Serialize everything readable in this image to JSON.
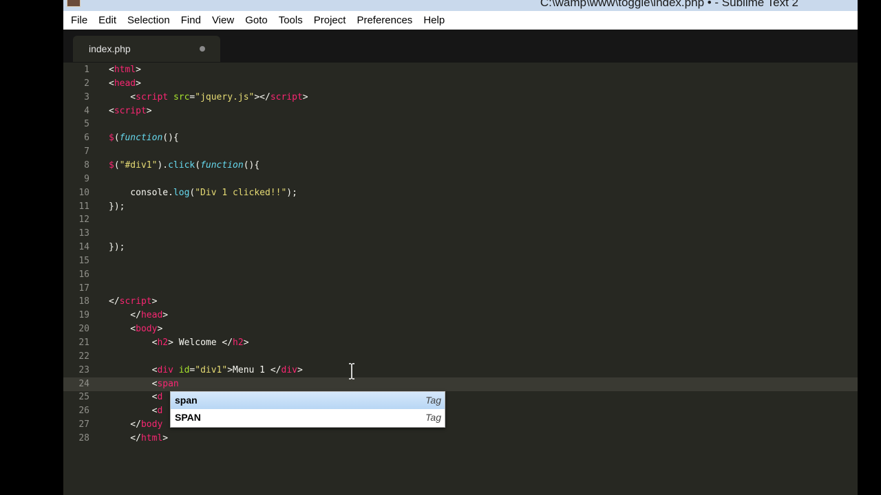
{
  "window": {
    "title": "C:\\wamp\\www\\toggle\\index.php • - Sublime Text 2"
  },
  "menu": [
    "File",
    "Edit",
    "Selection",
    "Find",
    "View",
    "Goto",
    "Tools",
    "Project",
    "Preferences",
    "Help"
  ],
  "tab": {
    "label": "index.php",
    "modified": true
  },
  "code_lines": [
    {
      "n": "1",
      "segs": [
        [
          "t-plain",
          "<"
        ],
        [
          "t-tag",
          "html"
        ],
        [
          "t-plain",
          ">"
        ]
      ]
    },
    {
      "n": "2",
      "segs": [
        [
          "t-plain",
          "<"
        ],
        [
          "t-tag",
          "head"
        ],
        [
          "t-plain",
          ">"
        ]
      ]
    },
    {
      "n": "3",
      "segs": [
        [
          "t-plain",
          "    <"
        ],
        [
          "t-tag",
          "script"
        ],
        [
          "t-plain",
          " "
        ],
        [
          "t-attr",
          "src"
        ],
        [
          "t-plain",
          "="
        ],
        [
          "t-str",
          "\"jquery.js\""
        ],
        [
          "t-plain",
          "></"
        ],
        [
          "t-tag",
          "script"
        ],
        [
          "t-plain",
          ">"
        ]
      ]
    },
    {
      "n": "4",
      "segs": [
        [
          "t-plain",
          "<"
        ],
        [
          "t-tag",
          "script"
        ],
        [
          "t-plain",
          ">"
        ]
      ]
    },
    {
      "n": "5",
      "segs": []
    },
    {
      "n": "6",
      "segs": [
        [
          "t-tag",
          "$"
        ],
        [
          "t-plain",
          "("
        ],
        [
          "t-fn",
          "function"
        ],
        [
          "t-plain",
          "(){"
        ]
      ]
    },
    {
      "n": "7",
      "segs": []
    },
    {
      "n": "8",
      "segs": [
        [
          "t-tag",
          "$"
        ],
        [
          "t-plain",
          "("
        ],
        [
          "t-str",
          "\"#div1\""
        ],
        [
          "t-plain",
          ")."
        ],
        [
          "t-call",
          "click"
        ],
        [
          "t-plain",
          "("
        ],
        [
          "t-fn",
          "function"
        ],
        [
          "t-plain",
          "(){"
        ]
      ]
    },
    {
      "n": "9",
      "segs": []
    },
    {
      "n": "10",
      "segs": [
        [
          "t-plain",
          "    console."
        ],
        [
          "t-call",
          "log"
        ],
        [
          "t-plain",
          "("
        ],
        [
          "t-str",
          "\"Div 1 clicked!!\""
        ],
        [
          "t-plain",
          ");"
        ]
      ]
    },
    {
      "n": "11",
      "segs": [
        [
          "t-plain",
          "});"
        ]
      ]
    },
    {
      "n": "12",
      "segs": []
    },
    {
      "n": "13",
      "segs": []
    },
    {
      "n": "14",
      "segs": [
        [
          "t-plain",
          "});"
        ]
      ]
    },
    {
      "n": "15",
      "segs": []
    },
    {
      "n": "16",
      "segs": []
    },
    {
      "n": "17",
      "segs": []
    },
    {
      "n": "18",
      "segs": [
        [
          "t-plain",
          "</"
        ],
        [
          "t-tag",
          "script"
        ],
        [
          "t-plain",
          ">"
        ]
      ]
    },
    {
      "n": "19",
      "segs": [
        [
          "t-plain",
          "    </"
        ],
        [
          "t-tag",
          "head"
        ],
        [
          "t-plain",
          ">"
        ]
      ]
    },
    {
      "n": "20",
      "segs": [
        [
          "t-plain",
          "    <"
        ],
        [
          "t-tag",
          "body"
        ],
        [
          "t-plain",
          ">"
        ]
      ]
    },
    {
      "n": "21",
      "segs": [
        [
          "t-plain",
          "        <"
        ],
        [
          "t-tag",
          "h2"
        ],
        [
          "t-plain",
          "> Welcome </"
        ],
        [
          "t-tag",
          "h2"
        ],
        [
          "t-plain",
          ">"
        ]
      ]
    },
    {
      "n": "22",
      "segs": []
    },
    {
      "n": "23",
      "segs": [
        [
          "t-plain",
          "        <"
        ],
        [
          "t-tag",
          "div"
        ],
        [
          "t-plain",
          " "
        ],
        [
          "t-attr",
          "id"
        ],
        [
          "t-plain",
          "="
        ],
        [
          "t-str",
          "\"div1\""
        ],
        [
          "t-plain",
          ">Menu 1 </"
        ],
        [
          "t-tag",
          "div"
        ],
        [
          "t-plain",
          ">"
        ]
      ]
    },
    {
      "n": "24",
      "current": true,
      "segs": [
        [
          "t-plain",
          "        <"
        ],
        [
          "t-tag",
          "span"
        ]
      ]
    },
    {
      "n": "25",
      "segs": [
        [
          "t-plain",
          "        <"
        ],
        [
          "t-tag",
          "d"
        ]
      ]
    },
    {
      "n": "26",
      "segs": [
        [
          "t-plain",
          "        <"
        ],
        [
          "t-tag",
          "d"
        ]
      ]
    },
    {
      "n": "27",
      "segs": [
        [
          "t-plain",
          "    </"
        ],
        [
          "t-tag",
          "body"
        ]
      ]
    },
    {
      "n": "28",
      "segs": [
        [
          "t-plain",
          "    </"
        ],
        [
          "t-tag",
          "html"
        ],
        [
          "t-plain",
          ">"
        ]
      ]
    }
  ],
  "autocomplete": [
    {
      "name": "span",
      "kind": "Tag",
      "selected": true
    },
    {
      "name": "SPAN",
      "kind": "Tag",
      "selected": false
    }
  ],
  "colors": {
    "editor_bg": "#272822",
    "tag": "#f92672",
    "attr": "#a6e22e",
    "string": "#e6db74",
    "function": "#66d9ef"
  }
}
